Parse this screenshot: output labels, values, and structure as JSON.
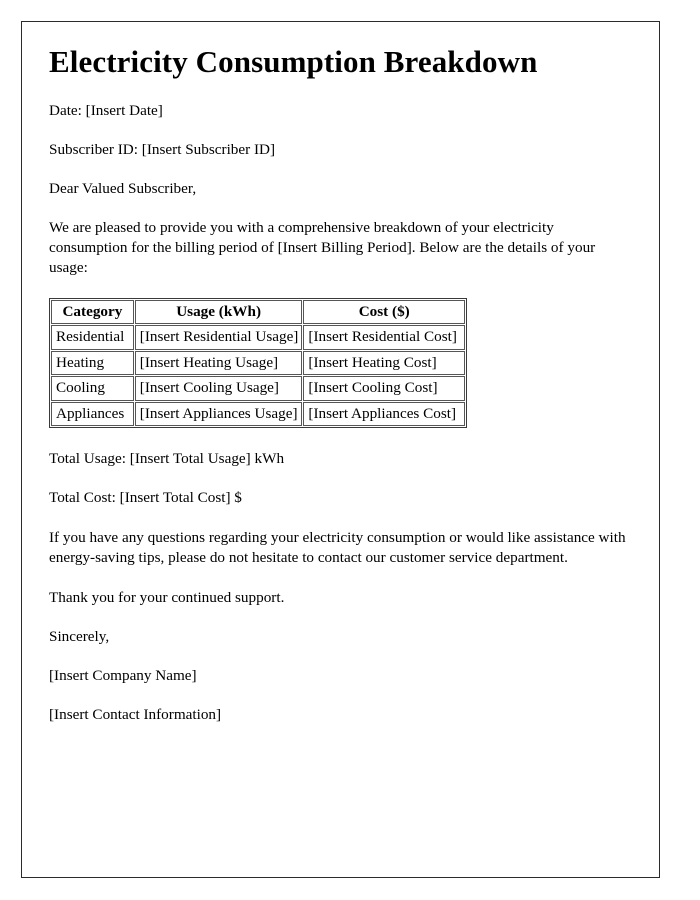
{
  "document": {
    "title": "Electricity Consumption Breakdown",
    "date_line": "Date: [Insert Date]",
    "subscriber_line": "Subscriber ID: [Insert Subscriber ID]",
    "salutation": "Dear Valued Subscriber,",
    "intro_paragraph": "We are pleased to provide you with a comprehensive breakdown of your electricity consumption for the billing period of [Insert Billing Period]. Below are the details of your usage:",
    "total_usage_line": "Total Usage: [Insert Total Usage] kWh",
    "total_cost_line": "Total Cost: [Insert Total Cost] $",
    "closing_paragraph": "If you have any questions regarding your electricity consumption or would like assistance with energy-saving tips, please do not hesitate to contact our customer service department.",
    "thanks_paragraph": "Thank you for your continued support.",
    "sign_off": "Sincerely,",
    "company_name": "[Insert Company Name]",
    "contact_information": "[Insert Contact Information]"
  },
  "table": {
    "headers": [
      "Category",
      "Usage (kWh)",
      "Cost ($)"
    ],
    "rows": [
      {
        "category": "Residential",
        "usage": "[Insert Residential Usage]",
        "cost": "[Insert Residential Cost]"
      },
      {
        "category": "Heating",
        "usage": "[Insert Heating Usage]",
        "cost": "[Insert Heating Cost]"
      },
      {
        "category": "Cooling",
        "usage": "[Insert Cooling Usage]",
        "cost": "[Insert Cooling Cost]"
      },
      {
        "category": "Appliances",
        "usage": "[Insert Appliances Usage]",
        "cost": "[Insert Appliances Cost]"
      }
    ]
  },
  "colors": {
    "page_background": "#ffffff",
    "text": "#000000",
    "page_border": "#2b2b2b",
    "table_border": "#565656"
  }
}
